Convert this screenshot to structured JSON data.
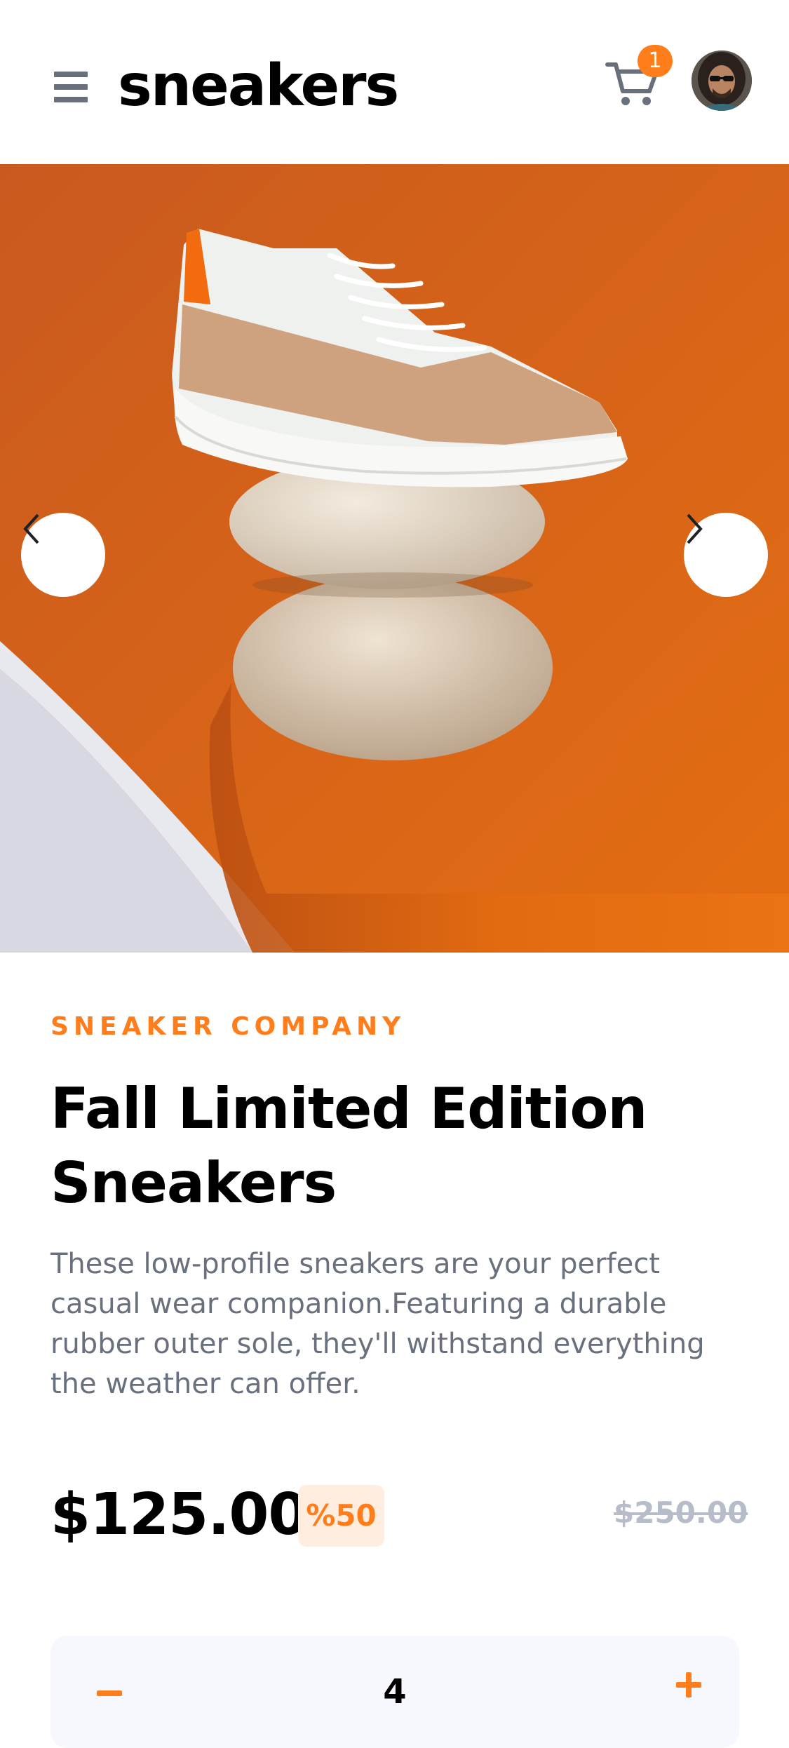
{
  "header": {
    "logo": "sneakers",
    "cart_count": "1"
  },
  "hero": {
    "prev_icon": "chevron-left-icon",
    "next_icon": "chevron-right-icon"
  },
  "product": {
    "company": "SNEAKER COMPANY",
    "title": "Fall Limited Edition Sneakers",
    "description": "These low-profile sneakers are your perfect casual wear companion.Featuring a durable rubber outer sole, they'll withstand everything the weather can offer.",
    "price": "$125.00",
    "discount": "%50",
    "original_price": "$250.00"
  },
  "quantity": {
    "value": "4"
  },
  "colors": {
    "accent": "#ff7e1b",
    "accent_pale": "#ffede0",
    "text_dark": "#1d2025",
    "text_muted": "#69707d",
    "strike": "#b6bcc8"
  }
}
